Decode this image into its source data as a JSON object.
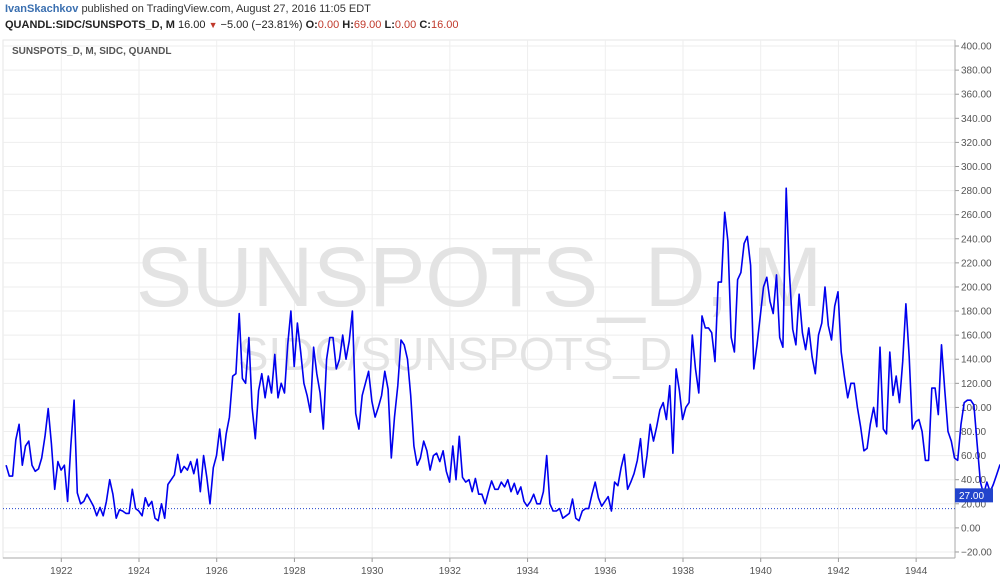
{
  "header": {
    "author": "IvanSkachkov",
    "published_text": "published on TradingView.com, August 27, 2016 11:05 EDT",
    "symbol": "QUANDL:SIDC/SUNSPOTS_D, M",
    "last": "16.00",
    "change": "−5.00 (−23.81%)",
    "o_label": "O:",
    "o_value": "0.00",
    "h_label": "H:",
    "h_value": "69.00",
    "l_label": "L:",
    "l_value": "0.00",
    "c_label": "C:",
    "c_value": "16.00"
  },
  "pane_label": "SUNSPOTS_D, M, SIDC, QUANDL",
  "watermark": {
    "main": "SUNSPOTS_D, M",
    "sub": "SIDC/SUNSPOTS_D"
  },
  "colors": {
    "series": "#0000ee",
    "change_negative": "#c0392b",
    "last_price_tag": "#2244cc",
    "author": "#3a6fb0"
  },
  "chart_data": {
    "type": "line",
    "series": [
      {
        "x_start": 1920.58,
        "x_step": 0.0833,
        "values": [
          52,
          43,
          43,
          73,
          86,
          52,
          68,
          72,
          52,
          47,
          49,
          58,
          76,
          99,
          70,
          32,
          55,
          48,
          52,
          22,
          68,
          106,
          29,
          20,
          22,
          28,
          23,
          18,
          10,
          17,
          10,
          22,
          40,
          28,
          8,
          15,
          14,
          12,
          12,
          32,
          16,
          14,
          10,
          25,
          18,
          22,
          8,
          6,
          20,
          8,
          36,
          40,
          44,
          61,
          46,
          51,
          48,
          55,
          45,
          57,
          30,
          60,
          42,
          20,
          50,
          60,
          82,
          56,
          78,
          92,
          126,
          128,
          178,
          124,
          120,
          158,
          100,
          74,
          114,
          128,
          108,
          126,
          112,
          144,
          108,
          120,
          112,
          152,
          180,
          134,
          170,
          146,
          120,
          110,
          96,
          150,
          128,
          112,
          82,
          140,
          158,
          158,
          132,
          140,
          160,
          140,
          155,
          180,
          95,
          82,
          110,
          120,
          130,
          105,
          92,
          100,
          110,
          130,
          115,
          58,
          92,
          118,
          156,
          152,
          140,
          110,
          68,
          52,
          58,
          72,
          64,
          48,
          60,
          62,
          55,
          64,
          47,
          38,
          68,
          40,
          76,
          42,
          38,
          40,
          30,
          41,
          28,
          28,
          20,
          30,
          39,
          32,
          32,
          38,
          34,
          40,
          30,
          37,
          28,
          34,
          22,
          18,
          22,
          28,
          20,
          20,
          30,
          60,
          20,
          14,
          14,
          16,
          8,
          10,
          12,
          24,
          8,
          6,
          14,
          16,
          16,
          28,
          38,
          25,
          18,
          22,
          26,
          14,
          38,
          35,
          50,
          61,
          32,
          38,
          45,
          56,
          74,
          42,
          60,
          86,
          72,
          84,
          98,
          104,
          90,
          118,
          62,
          132,
          114,
          90,
          100,
          104,
          160,
          132,
          112,
          176,
          166,
          166,
          162,
          138,
          204,
          204,
          262,
          238,
          158,
          146,
          206,
          212,
          236,
          242,
          218,
          132,
          152,
          176,
          200,
          208,
          188,
          178,
          210,
          158,
          150,
          282,
          212,
          165,
          152,
          194,
          162,
          148,
          166,
          142,
          128,
          160,
          170,
          200,
          168,
          156,
          184,
          196,
          146,
          126,
          108,
          120,
          120,
          100,
          84,
          64,
          66,
          86,
          100,
          84,
          150,
          82,
          78,
          146,
          110,
          126,
          104,
          138,
          186,
          142,
          82,
          88,
          90,
          80,
          56,
          56,
          116,
          116,
          94,
          152,
          114,
          80,
          72,
          58,
          56,
          86,
          104,
          106,
          106,
          102,
          70,
          38,
          28,
          38,
          30,
          36,
          44,
          52,
          54,
          42,
          58,
          34,
          28,
          48,
          50,
          38,
          25,
          56,
          20,
          18,
          22,
          42,
          30,
          22,
          14,
          28,
          18,
          20,
          14,
          30,
          8,
          20,
          34,
          6,
          4,
          24,
          10,
          14,
          16,
          24,
          14,
          14,
          40,
          26,
          36,
          48,
          22,
          16,
          46,
          36,
          27
        ]
      }
    ],
    "x_ticks": [
      "1922",
      "1924",
      "1926",
      "1928",
      "1930",
      "1932",
      "1934",
      "1936",
      "1938",
      "1940",
      "1942",
      "1944"
    ],
    "x_tick_values": [
      1922,
      1924,
      1926,
      1928,
      1930,
      1932,
      1934,
      1936,
      1938,
      1940,
      1942,
      1944
    ],
    "y_ticks": [
      "400.00",
      "380.00",
      "360.00",
      "340.00",
      "320.00",
      "300.00",
      "280.00",
      "260.00",
      "240.00",
      "220.00",
      "200.00",
      "180.00",
      "160.00",
      "140.00",
      "120.00",
      "100.00",
      "80.00",
      "60.00",
      "40.00",
      "20.00",
      "0.00",
      "−20.00"
    ],
    "y_tick_values": [
      400,
      380,
      360,
      340,
      320,
      300,
      280,
      260,
      240,
      220,
      200,
      180,
      160,
      140,
      120,
      100,
      80,
      60,
      40,
      20,
      0,
      -20
    ],
    "ylim": [
      -25,
      405
    ],
    "xlim": [
      1920.5,
      1945.0
    ],
    "last_price_line": 16,
    "last_price_tag": "27.00",
    "grid": true,
    "scale_side": "right"
  }
}
